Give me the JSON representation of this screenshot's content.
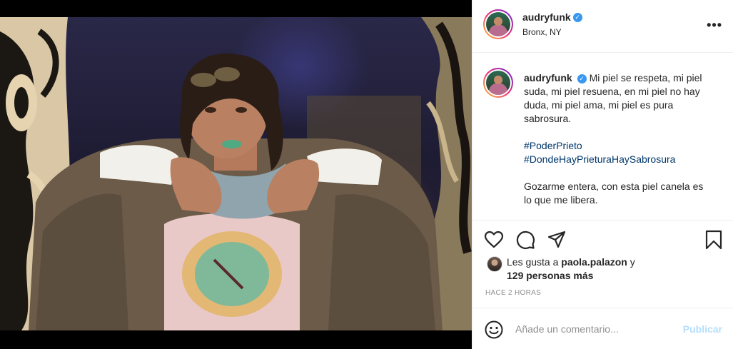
{
  "post": {
    "username": "audryfunk",
    "location": "Bronx, NY",
    "verified_mark": "✓",
    "more_label": "•••"
  },
  "caption": {
    "username": "audryfunk",
    "text_1": "Mi piel se respeta, mi piel suda, mi piel resuena, en mi piel no hay duda, mi piel ama, mi piel es pura sabrosura.",
    "hashtags": [
      "#PoderPrieto",
      "#DondeHayPrieturaHaySabrosura"
    ],
    "text_2": "Gozarme entera, con esta piel canela es lo que me libera."
  },
  "likes": {
    "prefix": "Les gusta a ",
    "user": "paola.palazon",
    "middle": " y",
    "others": "129 personas más"
  },
  "timestamp": "Hace 2 horas",
  "comment": {
    "placeholder": "Añade un comentario...",
    "publish_label": "Publicar"
  },
  "icons": {
    "like": "heart-icon",
    "comment": "comment-icon",
    "share": "share-icon",
    "save": "bookmark-icon",
    "emoji": "emoji-icon",
    "more": "more-options-icon"
  },
  "colors": {
    "text": "#262626",
    "muted": "#8e8e8e",
    "hashtag": "#00376b",
    "publish_disabled": "#b2dffc",
    "verified": "#3897f0",
    "border": "#efefef"
  }
}
